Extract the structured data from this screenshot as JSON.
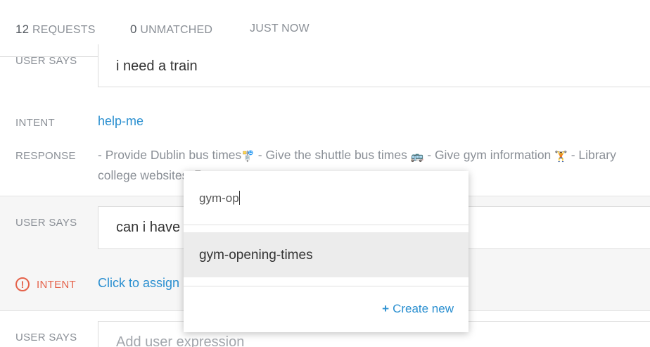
{
  "header": {
    "requests_count": "12",
    "requests_label": "REQUESTS",
    "unmatched_count": "0",
    "unmatched_label": "UNMATCHED",
    "time_label": "JUST NOW"
  },
  "entry1": {
    "user_says_label": "USER SAYS",
    "user_says_value": "i need a train",
    "intent_label": "INTENT",
    "intent_value": "help-me",
    "response_label": "RESPONSE",
    "response_part1": "- Provide Dublin bus times",
    "response_part2": " - Give the shuttle bus times ",
    "response_part3": " - Give gym information ",
    "response_part4": " - Library",
    "response_part5": "college websites ",
    "emoji1": "🚏",
    "emoji2": "🚌",
    "emoji3": "🏋",
    "emoji4": "📱"
  },
  "entry2": {
    "user_says_label": "USER SAYS",
    "user_says_value": "can i have",
    "intent_label": "INTENT",
    "intent_alert_icon": "!",
    "intent_value": "Click to assign"
  },
  "entry3": {
    "user_says_label": "USER SAYS",
    "placeholder": "Add user expression"
  },
  "dropdown": {
    "search_value": "gym-op",
    "option": "gym-opening-times",
    "create_plus": "+",
    "create_label": "Create new"
  }
}
